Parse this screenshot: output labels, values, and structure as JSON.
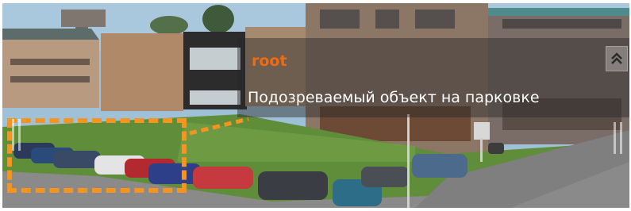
{
  "overlay": {
    "author": "root",
    "message": "Подозреваемый объект на парковке"
  },
  "icons": {
    "collapse": "double-chevron-up-icon"
  },
  "colors": {
    "author": "#f26a0f",
    "selection": "#f7941d",
    "message": "#ffffff"
  }
}
